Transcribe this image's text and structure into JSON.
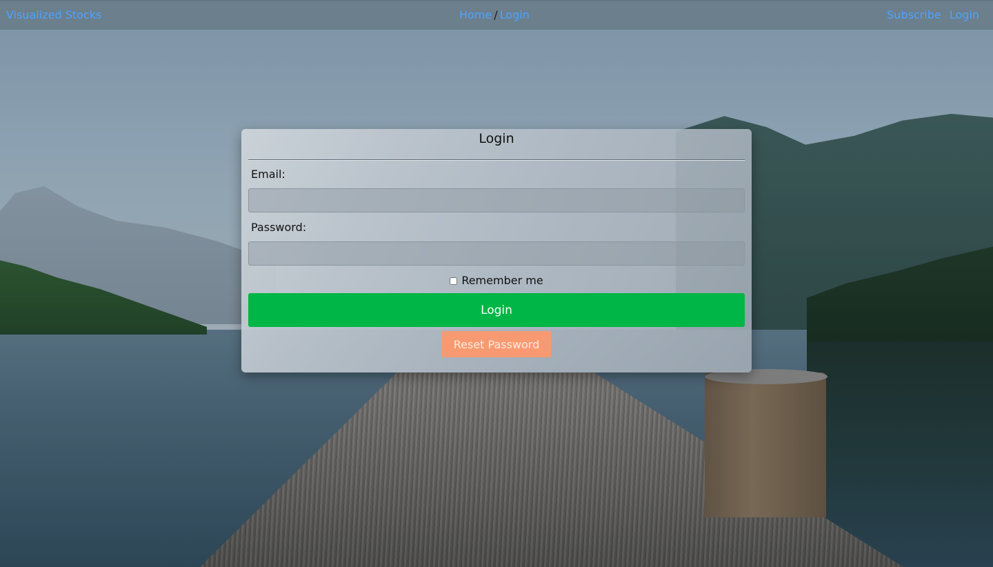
{
  "nav": {
    "brand": "Visualized Stocks",
    "breadcrumb": {
      "home": "Home",
      "separator": "/",
      "current": "Login"
    },
    "right_links": {
      "subscribe": "Subscribe",
      "login": "Login"
    }
  },
  "login_card": {
    "title": "Login",
    "email_label": "Email:",
    "email_value": "",
    "password_label": "Password:",
    "password_value": "",
    "remember_label": "Remember me",
    "remember_checked": false,
    "login_button": "Login",
    "reset_button": "Reset Password"
  },
  "colors": {
    "link": "#4da3ff",
    "login_button": "#00b646",
    "reset_button": "#f79a71",
    "topbar": "#6c7f8d"
  },
  "background": {
    "scene": "lake-dock-mountains-photo"
  }
}
